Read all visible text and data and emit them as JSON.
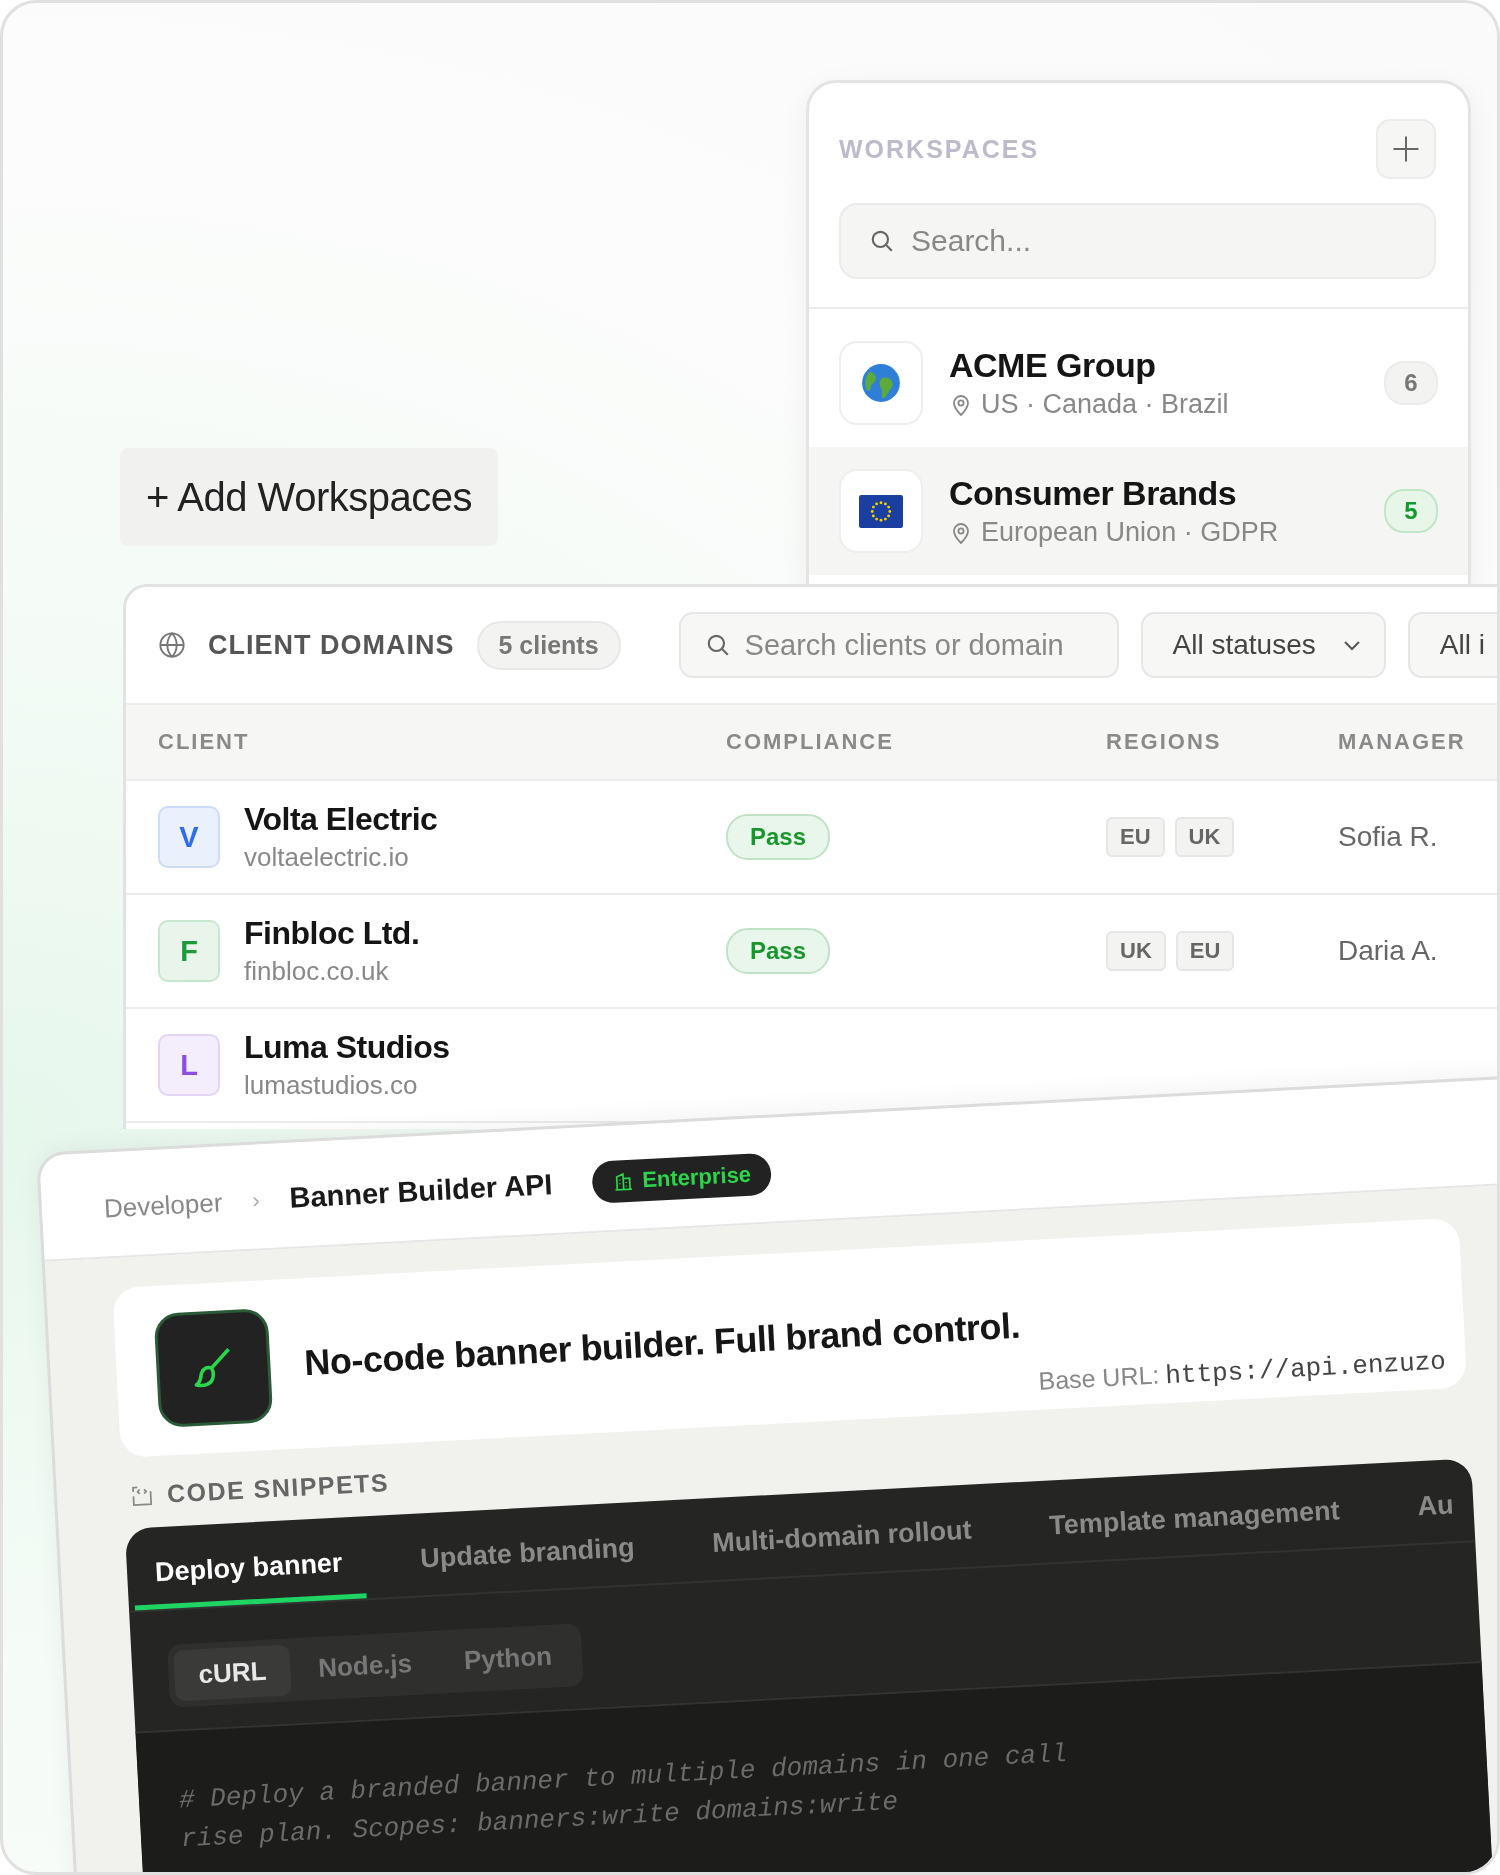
{
  "workspaces": {
    "title": "WORKSPACES",
    "search": {
      "placeholder": "Search..."
    },
    "items": [
      {
        "kind": "globe",
        "name": "ACME Group",
        "regions": "US · Canada · Brazil",
        "count": "6",
        "selected": false
      },
      {
        "kind": "eu-flag",
        "name": "Consumer Brands",
        "regions": "European Union · GDPR",
        "count": "5",
        "selected": true
      }
    ]
  },
  "add_workspaces_button": "+ Add Workspaces",
  "client_domains": {
    "title": "CLIENT DOMAINS",
    "count": "5 clients",
    "search": {
      "placeholder": "Search clients or domain"
    },
    "filters": [
      "All statuses",
      "All i"
    ],
    "columns": [
      "CLIENT",
      "COMPLIANCE",
      "REGIONS",
      "MANAGER"
    ],
    "rows": [
      {
        "initial": "V",
        "color": "#2f6fe4",
        "name": "Volta Electric",
        "domain": "voltaelectric.io",
        "compliance": "Pass",
        "regions": [
          "EU",
          "UK"
        ],
        "manager": "Sofia R."
      },
      {
        "initial": "F",
        "color": "#1f9a3a",
        "name": "Finbloc Ltd.",
        "domain": "finbloc.co.uk",
        "compliance": "Pass",
        "regions": [
          "UK",
          "EU"
        ],
        "manager": "Daria A."
      },
      {
        "initial": "L",
        "color": "#8a4fe0",
        "name": "Luma Studios",
        "domain": "lumastudios.co"
      }
    ]
  },
  "developer": {
    "breadcrumb": [
      "Developer",
      "Banner Builder API"
    ],
    "breadcrumb_separator": "›",
    "badge": "Enterprise",
    "headline": "No-code banner builder. Full brand control.",
    "base_url_label": "Base URL:",
    "base_url": "https://api.enzuzo",
    "snippets_title": "CODE SNIPPETS",
    "tabs": [
      {
        "label": "Deploy banner",
        "selected": true
      },
      {
        "label": "Update branding",
        "selected": false
      },
      {
        "label": "Multi-domain rollout",
        "selected": false
      },
      {
        "label": "Template management",
        "selected": false
      },
      {
        "label": "Au",
        "selected": false
      }
    ],
    "languages": [
      {
        "label": "cURL",
        "selected": true
      },
      {
        "label": "Node.js",
        "selected": false
      },
      {
        "label": "Python",
        "selected": false
      }
    ],
    "code_lines": [
      "# Deploy a branded banner to multiple domains in one call",
      "rise plan. Scopes: banners:write domains:write"
    ]
  }
}
